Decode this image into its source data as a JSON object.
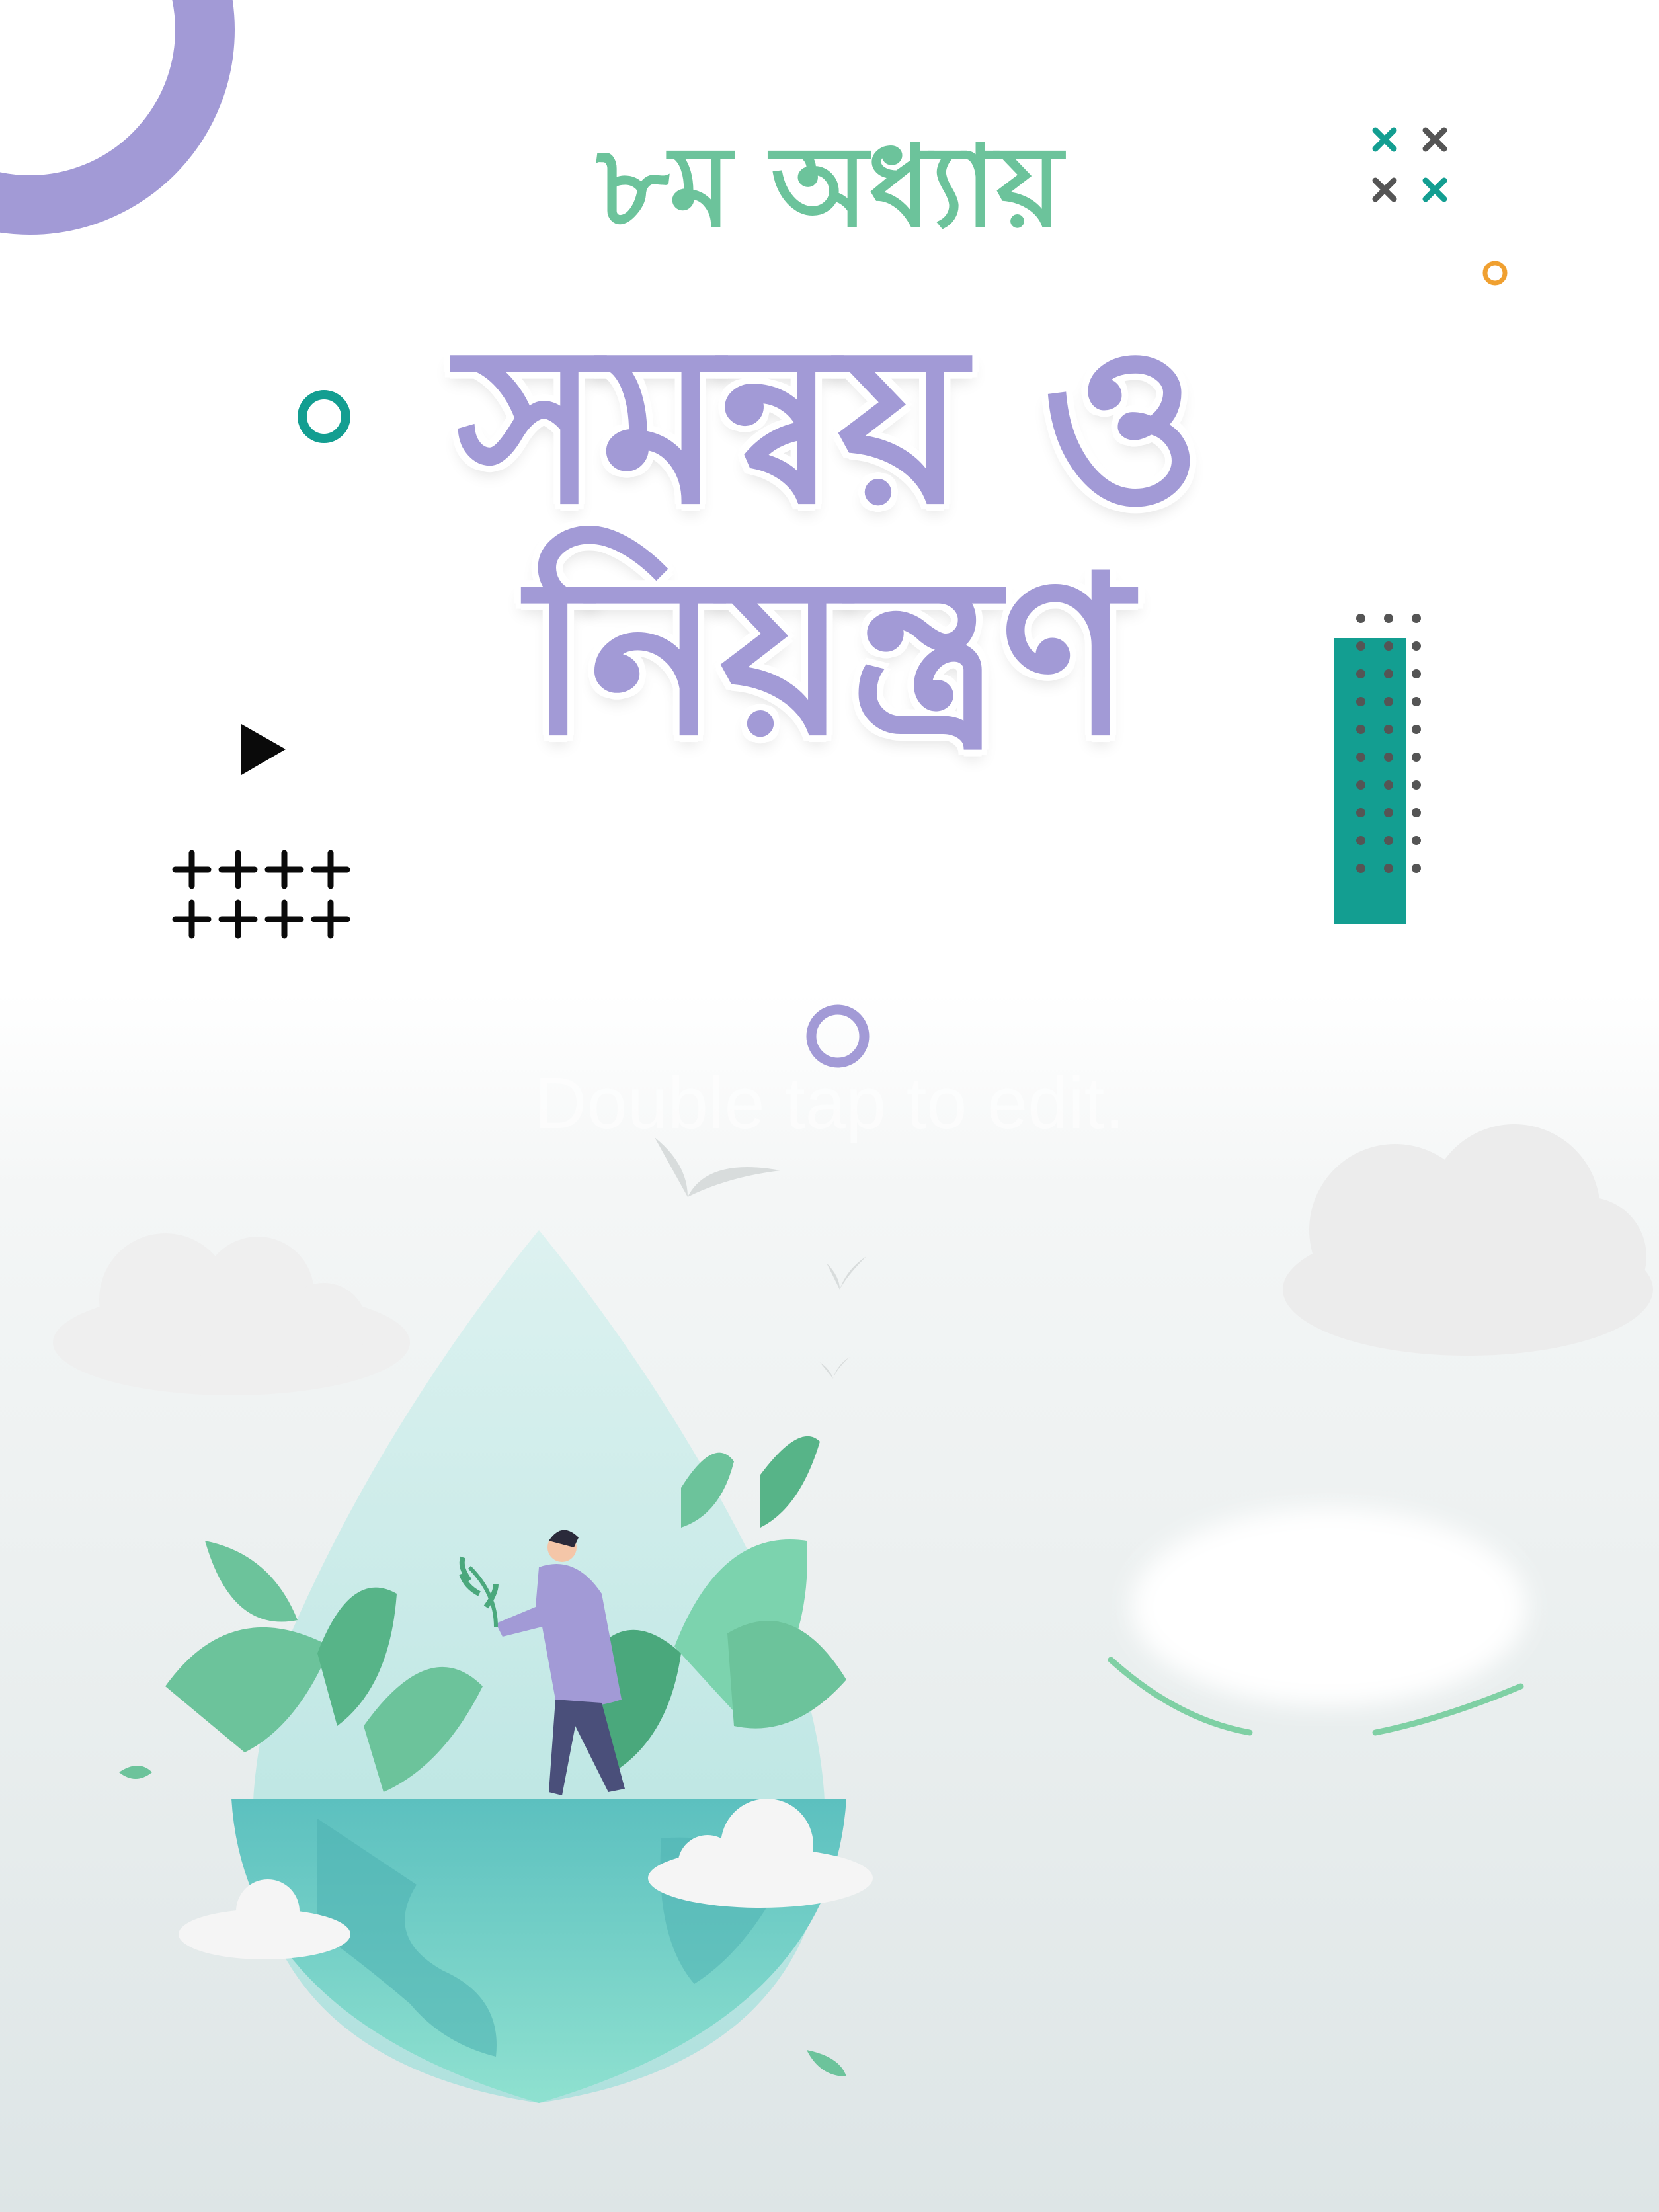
{
  "cover": {
    "chapter_label": "৮ম অধ্যায়",
    "title_line1": "সমন্বয় ও",
    "title_line2": "নিয়ন্ত্রণ",
    "edit_hint": "Double tap to edit."
  },
  "icons": {
    "ring": "ring-icon",
    "play": "play-triangle-icon",
    "plus_grid": "plus-grid-icon",
    "x_marks": "x-marks-icon",
    "dots": "dot-grid-icon",
    "illustration": "water-drop-earth-illustration"
  },
  "colors": {
    "accent_purple": "#a29ad6",
    "accent_green": "#6cc39b",
    "teal": "#139e91",
    "orange": "#f0a030"
  }
}
